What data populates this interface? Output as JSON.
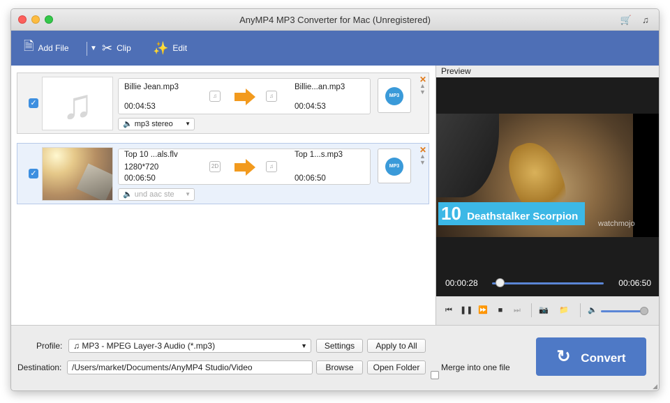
{
  "window": {
    "title": "AnyMP4 MP3 Converter for Mac (Unregistered)"
  },
  "toolbar": {
    "add_file": "Add File",
    "clip": "Clip",
    "edit": "Edit"
  },
  "files": [
    {
      "source_name": "Billie Jean.mp3",
      "source_duration": "00:04:53",
      "source_resolution": "",
      "target_name": "Billie...an.mp3",
      "target_duration": "00:04:53",
      "audio_track": "mp3 stereo",
      "checked": true
    },
    {
      "source_name": "Top 10 ...als.flv",
      "source_resolution": "1280*720",
      "source_duration": "00:06:50",
      "target_name": "Top 1...s.mp3",
      "target_duration": "00:06:50",
      "audio_track": "und aac ste",
      "checked": true
    }
  ],
  "preview": {
    "label": "Preview",
    "banner_number": "10",
    "banner_text": "Deathstalker Scorpion",
    "watermark": "watchmojo",
    "current_time": "00:00:28",
    "total_time": "00:06:50",
    "progress": 0.068
  },
  "bottom": {
    "profile_label": "Profile:",
    "profile_value": "MP3 - MPEG Layer-3 Audio (*.mp3)",
    "settings": "Settings",
    "apply_to_all": "Apply to All",
    "destination_label": "Destination:",
    "destination_value": "/Users/market/Documents/AnyMP4 Studio/Video",
    "browse": "Browse",
    "open_folder": "Open Folder",
    "merge_label": "Merge into one file",
    "convert": "Convert"
  },
  "colors": {
    "toolbar": "#4e6fb6",
    "accent": "#4e79c6",
    "arrow": "#f29a1e"
  }
}
